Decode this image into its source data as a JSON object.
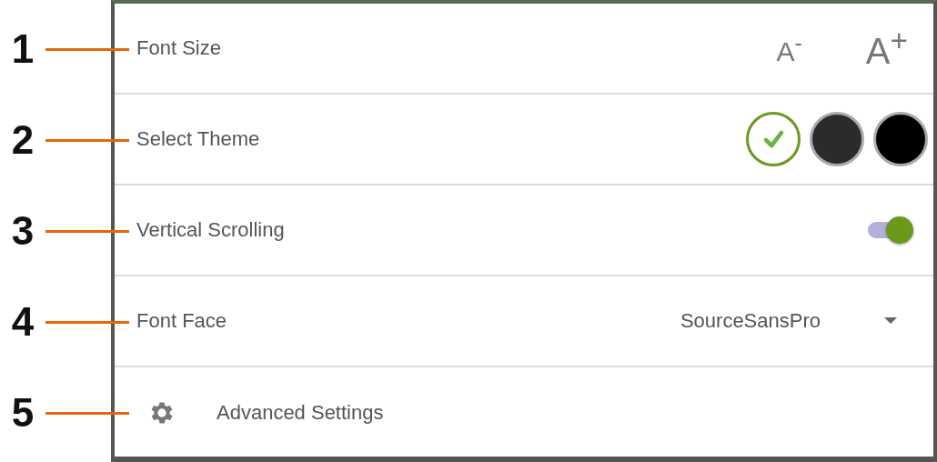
{
  "callouts": [
    "1",
    "2",
    "3",
    "4",
    "5"
  ],
  "settings": [
    {
      "kind": "font_size",
      "label": "Font Size",
      "decrease": "A$^{-}$",
      "increase": "A$^{+}$"
    },
    {
      "kind": "theme",
      "label": "Select Theme",
      "options": [
        {
          "color": "#ffffff",
          "selected": true
        },
        {
          "color": "#2b2b2b",
          "selected": false
        },
        {
          "color": "#000000",
          "selected": false
        }
      ]
    },
    {
      "kind": "toggle",
      "label": "Vertical Scrolling",
      "on": true
    },
    {
      "kind": "dropdown",
      "label": "Font Face",
      "value": "SourceSansPro"
    },
    {
      "kind": "link",
      "label": "Advanced Settings"
    }
  ]
}
